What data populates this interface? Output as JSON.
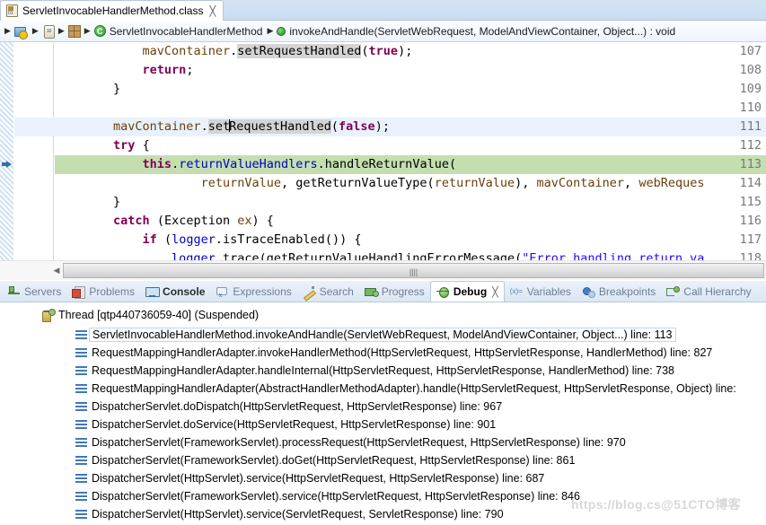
{
  "editor_tab": {
    "title": "ServletInvocableHandlerMethod.class",
    "close_label": "╳",
    "icon": "class-file-icon"
  },
  "breadcrumb": {
    "separator": "▶",
    "items": [
      {
        "label": "",
        "icon": "project-icon"
      },
      {
        "label": "",
        "icon": "jar-library-icon"
      },
      {
        "label": "",
        "icon": "package-icon"
      },
      {
        "label": "ServletInvocableHandlerMethod",
        "icon": "java-class-icon"
      },
      {
        "label": "invokeAndHandle(ServletWebRequest, ModelAndViewContainer, Object...) : void",
        "icon": "java-method-icon"
      }
    ]
  },
  "code": {
    "first_line": 107,
    "lines": [
      {
        "number": "107",
        "state": "normal"
      },
      {
        "number": "108",
        "state": "normal"
      },
      {
        "number": "109",
        "state": "normal"
      },
      {
        "number": "110",
        "state": "normal"
      },
      {
        "number": "111",
        "state": "cursor"
      },
      {
        "number": "112",
        "state": "normal"
      },
      {
        "number": "113",
        "state": "executing"
      },
      {
        "number": "114",
        "state": "normal"
      },
      {
        "number": "115",
        "state": "normal"
      },
      {
        "number": "116",
        "state": "normal"
      },
      {
        "number": "117",
        "state": "normal"
      },
      {
        "number": "118",
        "state": "normal"
      }
    ],
    "text": {
      "l107": "            mavContainer.setRequestHandled(true);",
      "l108": "            return;",
      "l109": "        }",
      "l110": "",
      "l111": "        mavContainer.setRequestHandled(false);",
      "l112": "        try {",
      "l113": "            this.returnValueHandlers.handleReturnValue(",
      "l114": "                    returnValue, getReturnValueType(returnValue), mavContainer, webReques",
      "l115": "        }",
      "l116": "        catch (Exception ex) {",
      "l117": "            if (logger.isTraceEnabled()) {",
      "l118": "                logger.trace(getReturnValueHandlingErrorMessage(\"Error handling return va"
    },
    "tokens": {
      "mavContainer": "mavContainer",
      "dot": ".",
      "setRequestHandled": "setRequestHandled",
      "paren_open": "(",
      "paren_close": ")",
      "semi": ";",
      "true": "true",
      "false": "false",
      "return": "return",
      "try": "try",
      "catch": "catch",
      "if": "if",
      "this": "this",
      "brace_open": "{",
      "brace_close": "}",
      "returnValueHandlers": "returnValueHandlers",
      "handleReturnValue": "handleReturnValue",
      "returnValue": "returnValue",
      "comma_sp": ", ",
      "getReturnValueType": "getReturnValueType",
      "webReques": "webReques",
      "Exception": "Exception",
      "ex": "ex",
      "logger": "logger",
      "isTraceEnabled": "isTraceEnabled",
      "trace": "trace",
      "getReturnValueHandlingErrorMessage": "getReturnValueHandlingErrorMessage",
      "string_literal": "\"Error handling return va"
    },
    "scrollbar": {
      "left_arrow": "◀",
      "grip": "||||"
    }
  },
  "view_tabs": [
    {
      "label": "Servers",
      "icon": "servers-icon",
      "state": "inactive"
    },
    {
      "label": "Problems",
      "icon": "problems-icon",
      "state": "inactive"
    },
    {
      "label": "Console",
      "icon": "console-icon",
      "state": "emphasized"
    },
    {
      "label": "Expressions",
      "icon": "expressions-icon",
      "state": "inactive"
    },
    {
      "label": "Search",
      "icon": "search-icon",
      "state": "inactive"
    },
    {
      "label": "Progress",
      "icon": "progress-icon",
      "state": "inactive"
    },
    {
      "label": "Debug",
      "icon": "debug-bug-icon",
      "state": "active",
      "close_label": "╳"
    },
    {
      "label": "Variables",
      "icon": "variables-icon",
      "state": "inactive"
    },
    {
      "label": "Breakpoints",
      "icon": "breakpoints-icon",
      "state": "inactive"
    },
    {
      "label": "Call Hierarchy",
      "icon": "call-hierarchy-icon",
      "state": "inactive"
    }
  ],
  "debug": {
    "thread": {
      "label": "Thread [qtp440736059-40] (Suspended)",
      "expanded": true,
      "icon": "thread-icon"
    },
    "frames": [
      {
        "label": "ServletInvocableHandlerMethod.invokeAndHandle(ServletWebRequest, ModelAndViewContainer, Object...) line: 113",
        "selected": true
      },
      {
        "label": "RequestMappingHandlerAdapter.invokeHandlerMethod(HttpServletRequest, HttpServletResponse, HandlerMethod) line: 827",
        "selected": false
      },
      {
        "label": "RequestMappingHandlerAdapter.handleInternal(HttpServletRequest, HttpServletResponse, HandlerMethod) line: 738",
        "selected": false
      },
      {
        "label": "RequestMappingHandlerAdapter(AbstractHandlerMethodAdapter).handle(HttpServletRequest, HttpServletResponse, Object) line:",
        "selected": false
      },
      {
        "label": "DispatcherServlet.doDispatch(HttpServletRequest, HttpServletResponse) line: 967",
        "selected": false
      },
      {
        "label": "DispatcherServlet.doService(HttpServletRequest, HttpServletResponse) line: 901",
        "selected": false
      },
      {
        "label": "DispatcherServlet(FrameworkServlet).processRequest(HttpServletRequest, HttpServletResponse) line: 970",
        "selected": false
      },
      {
        "label": "DispatcherServlet(FrameworkServlet).doGet(HttpServletRequest, HttpServletResponse) line: 861",
        "selected": false
      },
      {
        "label": "DispatcherServlet(HttpServlet).service(HttpServletRequest, HttpServletResponse) line: 687",
        "selected": false
      },
      {
        "label": "DispatcherServlet(FrameworkServlet).service(HttpServletRequest, HttpServletResponse) line: 846",
        "selected": false
      },
      {
        "label": "DispatcherServlet(HttpServlet).service(ServletRequest, ServletResponse) line: 790",
        "selected": false
      }
    ]
  },
  "watermark": {
    "text": "https://blog.cs@51CTO博客"
  },
  "colors": {
    "keyword": "#7f0055",
    "string": "#2a00ff",
    "field": "#0000c0",
    "local": "#6a3e0a",
    "exec_line_bg": "#c4deb0",
    "cursor_line_bg": "#e9f2fc",
    "occurrence_bg": "#d4d4d4",
    "tab_active_bg": "#ffffff",
    "chrome_bg": "#dbe7f4"
  }
}
